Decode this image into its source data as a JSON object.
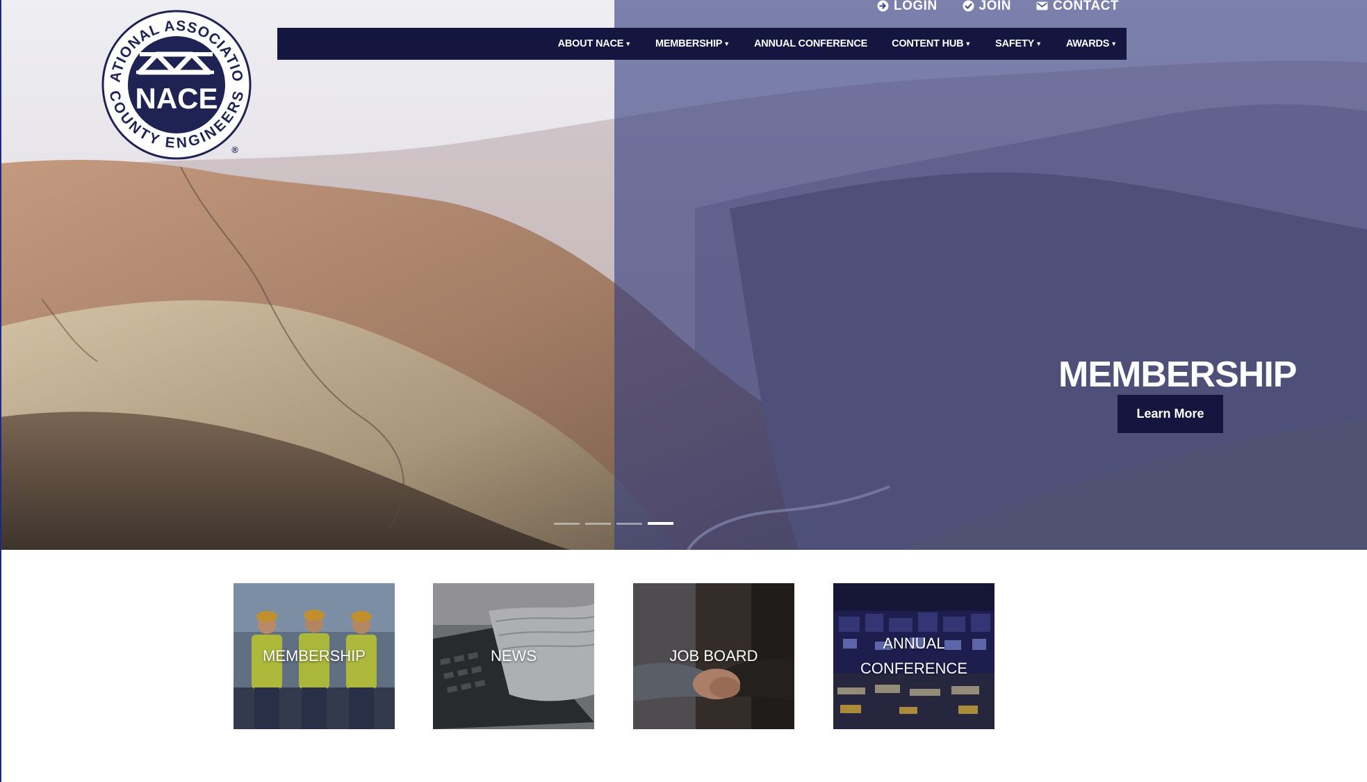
{
  "utility_nav": [
    {
      "label": "LOGIN",
      "icon": "login-arrow-icon"
    },
    {
      "label": "JOIN",
      "icon": "check-circle-icon"
    },
    {
      "label": "CONTACT",
      "icon": "envelope-icon"
    }
  ],
  "main_nav": [
    {
      "label": "ABOUT NACE",
      "dropdown": true
    },
    {
      "label": "MEMBERSHIP",
      "dropdown": true
    },
    {
      "label": "ANNUAL CONFERENCE",
      "dropdown": false
    },
    {
      "label": "CONTENT HUB",
      "dropdown": true
    },
    {
      "label": "SAFETY",
      "dropdown": true
    },
    {
      "label": "AWARDS",
      "dropdown": true
    }
  ],
  "logo": {
    "top_text": "NATIONAL ASSOCIATION",
    "bottom_text": "COUNTY ENGINEERS",
    "center_text": "NACE",
    "registered": "®"
  },
  "hero": {
    "title": "MEMBERSHIP",
    "button_label": "Learn More",
    "slide_count": 4,
    "active_slide": 4
  },
  "tiles": [
    {
      "label": "MEMBERSHIP"
    },
    {
      "label": "NEWS"
    },
    {
      "label": "JOB BOARD"
    },
    {
      "label": "ANNUAL\nCONFERENCE"
    }
  ],
  "colors": {
    "navy": "#14163f",
    "overlay": "#343e80",
    "frame": "#1a2a8a"
  }
}
